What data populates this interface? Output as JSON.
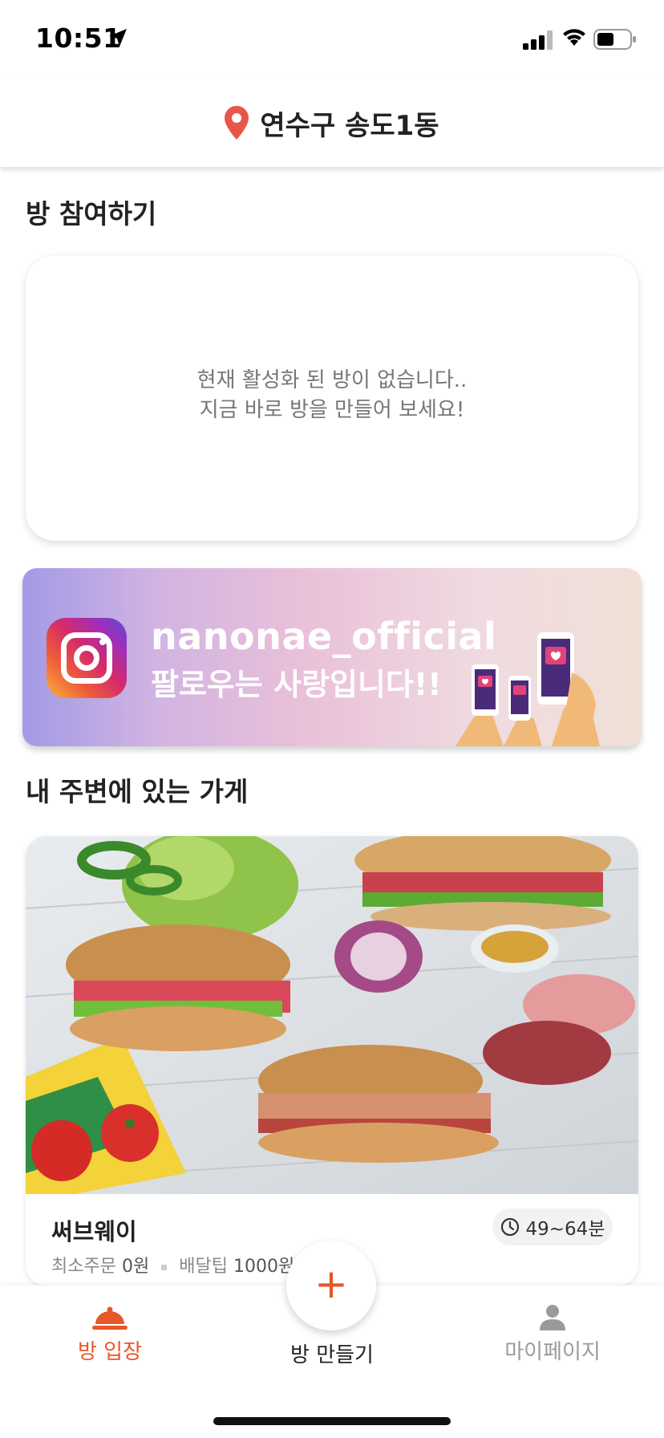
{
  "status_bar": {
    "time": "10:51"
  },
  "header": {
    "location": "연수구 송도1동",
    "accent": "#e8564a"
  },
  "join_section": {
    "title": "방 참여하기",
    "empty_line1": "현재 활성화 된 방이 없습니다..",
    "empty_line2": "지금 바로 방을 만들어 보세요!"
  },
  "banner": {
    "line1": "nanonae_official",
    "line2": "팔로우는 사랑입니다!!",
    "icon": "instagram-icon"
  },
  "nearby_section": {
    "title": "내 주변에 있는 가게",
    "stores": [
      {
        "name": "써브웨이",
        "min_order_label": "최소주문",
        "min_order_value": "0원",
        "delivery_tip_label": "배달팁",
        "delivery_tip_value": "1000원",
        "delivery_time": "49~64분"
      }
    ]
  },
  "tab_bar": {
    "active_color": "#e8562a",
    "inactive_color": "#9a9a9a",
    "rooms_label": "방 입장",
    "create_label": "방 만들기",
    "create_plus": "+",
    "mypage_label": "마이페이지"
  }
}
